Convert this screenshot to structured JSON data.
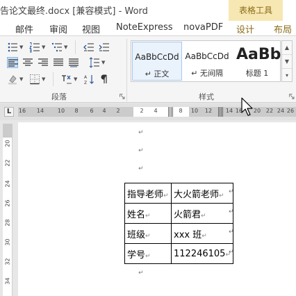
{
  "window": {
    "title": "告论文最终.docx [兼容模式] - Word",
    "context_group": "表格工具"
  },
  "tabs": [
    {
      "label": "邮件",
      "ctx": false
    },
    {
      "label": "审阅",
      "ctx": false
    },
    {
      "label": "视图",
      "ctx": false
    },
    {
      "label": "NoteExpress",
      "ctx": false
    },
    {
      "label": "novaPDF",
      "ctx": false
    },
    {
      "label": "设计",
      "ctx": true
    },
    {
      "label": "布局",
      "ctx": true
    }
  ],
  "groups": {
    "paragraph": "段落",
    "styles": "样式"
  },
  "styles": [
    {
      "sample": "AaBbCcDd",
      "name": "↵ 正文",
      "selected": true
    },
    {
      "sample": "AaBbCcDd",
      "name": "↵ 无间隔",
      "selected": false
    },
    {
      "sample": "AaBb",
      "name": "标题 1",
      "selected": false
    }
  ],
  "ruler": {
    "corner": "L",
    "horizontal": [
      "16",
      "14",
      "10",
      "8",
      "6",
      "4",
      "2",
      "2",
      "4",
      "8",
      "10",
      "12",
      "14",
      "16",
      "20",
      "22",
      "24",
      "26"
    ],
    "vertical": [
      "20",
      "22",
      "24",
      "26",
      "28",
      "30",
      "32",
      "34"
    ]
  },
  "document": {
    "para_mark": "↵",
    "table": [
      [
        "指导老师",
        "大火箭老师"
      ],
      [
        "姓名",
        "火箭君"
      ],
      [
        "班级",
        "xxx 班"
      ],
      [
        "学号",
        "112246105"
      ]
    ]
  }
}
